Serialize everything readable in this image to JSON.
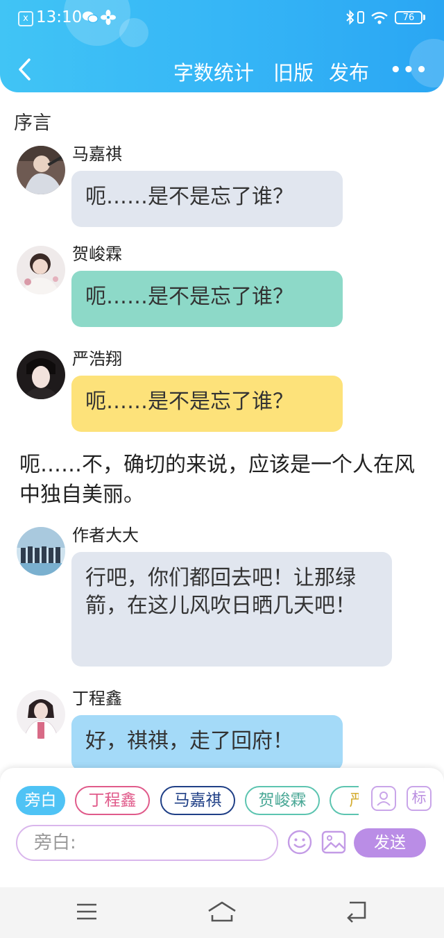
{
  "status_bar": {
    "time": "13:10",
    "battery": "76"
  },
  "nav": {
    "title": "字数统计",
    "old_version": "旧版",
    "publish": "发布",
    "more": "•••"
  },
  "section_title": "序言",
  "messages": [
    {
      "name": "马嘉祺",
      "text": "呃……是不是忘了谁？"
    },
    {
      "name": "贺峻霖",
      "text": "呃……是不是忘了谁？"
    },
    {
      "name": "严浩翔",
      "text": "呃……是不是忘了谁？"
    }
  ],
  "narration": "呃……不，确切的来说，应该是一个人在风中独自美丽。",
  "messages2": [
    {
      "name": "作者大大",
      "text": "行吧，你们都回去吧！让那绿箭，在这儿风吹日晒几天吧！"
    },
    {
      "name": "丁程鑫",
      "text": "好，祺祺，走了回府！"
    }
  ],
  "chips": [
    "旁白",
    "丁程鑫",
    "马嘉祺",
    "贺峻霖",
    "严"
  ],
  "tag_label": "标",
  "input": {
    "placeholder": "旁白:"
  },
  "send_label": "发送",
  "colors": {
    "header_accent": "#36b6f6",
    "bubble_gray": "#e1e6ef",
    "bubble_teal": "#8dd9c8",
    "bubble_yellow": "#fde27a",
    "bubble_blue": "#a4daf8",
    "send_purple": "#ba8de6"
  }
}
